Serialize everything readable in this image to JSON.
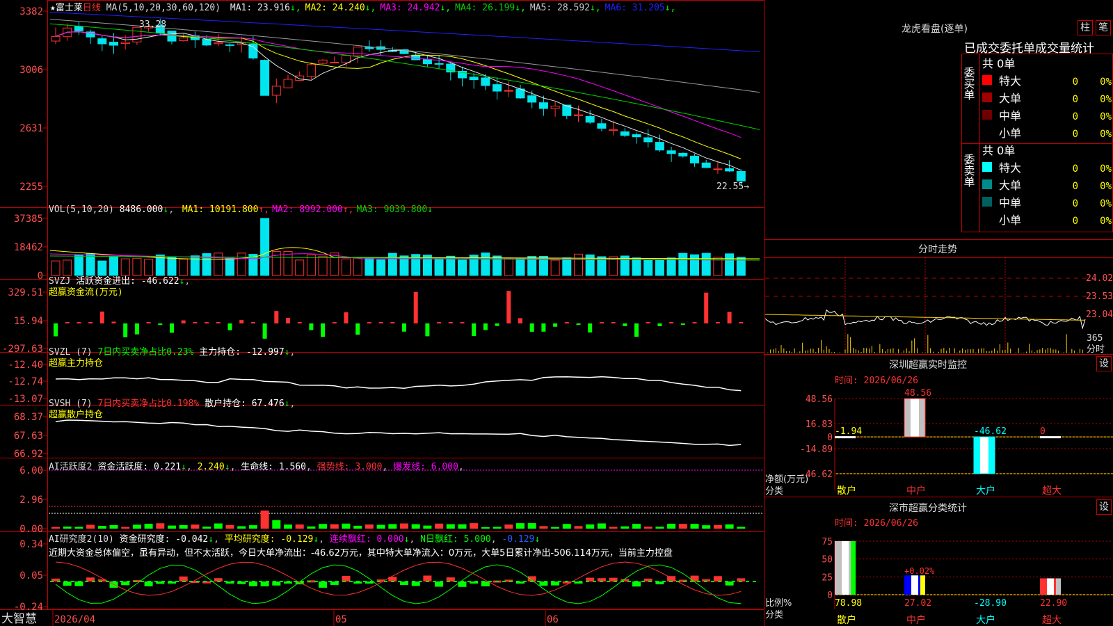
{
  "colors": {
    "up": "#ff3232",
    "down": "#00e5ee",
    "frame": "#c00000",
    "axis_text": "#ff5050",
    "ma1": "#e6e6e6",
    "ma2": "#ffff00",
    "ma3": "#ff00ff",
    "ma4": "#00d000",
    "ma5": "#9a9a9a",
    "ma6": "#2020ff",
    "green_bar": "#00ff00"
  },
  "main": {
    "stock_name": "富士莱",
    "period": "日线",
    "ma_header": "MA(5,10,20,30,60,120)",
    "ma_legend": [
      {
        "label": "MA1:",
        "value": "23.916",
        "color": "#e6e6e6"
      },
      {
        "label": "MA2:",
        "value": "24.240",
        "color": "#ffff00"
      },
      {
        "label": "MA3:",
        "value": "24.942",
        "color": "#ff00ff"
      },
      {
        "label": "MA4:",
        "value": "26.199",
        "color": "#00d000"
      },
      {
        "label": "MA5:",
        "value": "28.592",
        "color": "#c8c8c8"
      },
      {
        "label": "MA6:",
        "value": "31.205",
        "color": "#2020ff"
      }
    ],
    "y_ticks": [
      "3382",
      "3006",
      "2631",
      "2255"
    ],
    "high_annotation": "33.28",
    "low_annotation": "22.55"
  },
  "vol": {
    "header": "VOL(5,10,20)",
    "value": "8486.000",
    "legend": [
      {
        "label": "MA1:",
        "value": "10191.800",
        "color": "#ffff00"
      },
      {
        "label": "MA2:",
        "value": "8992.000",
        "color": "#ff00ff"
      },
      {
        "label": "MA3:",
        "value": "9039.800",
        "color": "#00d000"
      }
    ],
    "y_ticks": [
      "37385",
      "18462",
      "0"
    ]
  },
  "svzj": {
    "header": "SVZJ",
    "label": "活跃资金进出:",
    "value": "-46.622",
    "subtitle": "超赢资金流(万元)",
    "y_ticks": [
      "329.51",
      "15.94",
      "-297.63"
    ]
  },
  "svzl": {
    "header": "SVZL (7)",
    "ratio_text": "7日内买卖净占比0.23%",
    "label": "主力持仓:",
    "value": "-12.997",
    "subtitle": "超赢主力持仓",
    "y_ticks": [
      "-12.40",
      "-12.74",
      "-13.07"
    ]
  },
  "svsh": {
    "header": "SVSH (7)",
    "ratio_text": "7日内买卖净占比0.198%",
    "label": "散户持仓:",
    "value": "67.476",
    "subtitle": "超赢散户持仓",
    "y_ticks": [
      "68.37",
      "67.63",
      "66.92"
    ]
  },
  "ai_active": {
    "header": "AI活跃度2",
    "label": "资金活跃度:",
    "value1": "0.221",
    "value2": "2.240",
    "life_label": "生命线:",
    "life_value": "1.560",
    "strong": "强势线: 3.000",
    "burst": "爆发线: 6.000",
    "y_ticks": [
      "6.00",
      "2.96",
      "0.00"
    ]
  },
  "ai_research": {
    "header": "AI研究度2(10)",
    "label": "资金研究度:",
    "value": "-0.042",
    "avg": "平均研究度: -0.129",
    "consec": "连续飘红: 0.000",
    "nday": "N日飘红: 5.000",
    "last": "-0.129",
    "commentary": "近期大资金总体偏空，虽有异动，但不太活跃，今日大单净流出：-46.62万元，其中特大单净流入：0万元，大单5日累计净出-506.114万元，当前主力控盘",
    "y_ticks": [
      "0.34",
      "0.05",
      "-0.24"
    ]
  },
  "x_axis": {
    "brand": "大智慧",
    "labels": [
      "2026/04",
      "05",
      "06"
    ]
  },
  "right": {
    "lhkp_title": "龙虎看盘(逐单)",
    "btn_zhu": "柱",
    "btn_bi": "笔",
    "stats_title": "已成交委托单成交量统计",
    "buy_side": "委买单",
    "sell_side": "委卖单",
    "buy_total": "共 0单",
    "sell_total": "共 0单",
    "buy_rows": [
      {
        "name": "特大",
        "qty": "0",
        "pct": "0%",
        "color": "#ff0000"
      },
      {
        "name": "大单",
        "qty": "0",
        "pct": "0%",
        "color": "#a00000"
      },
      {
        "name": "中单",
        "qty": "0",
        "pct": "0%",
        "color": "#700000"
      },
      {
        "name": "小单",
        "qty": "0",
        "pct": "0%",
        "color": "#000000"
      }
    ],
    "sell_rows": [
      {
        "name": "特大",
        "qty": "0",
        "pct": "0%",
        "color": "#00ffff"
      },
      {
        "name": "大单",
        "qty": "0",
        "pct": "0%",
        "color": "#008b8b"
      },
      {
        "name": "中单",
        "qty": "0",
        "pct": "0%",
        "color": "#006060"
      },
      {
        "name": "小单",
        "qty": "0",
        "pct": "0%",
        "color": "#000000"
      }
    ],
    "intraday_title": "分时走势",
    "intraday_ticks": [
      "24.02",
      "23.53",
      "23.04"
    ],
    "intraday_vol": "365",
    "intraday_unit": "分时",
    "monitor_title": "深圳超赢实时监控",
    "monitor_btn": "设",
    "monitor_time": "时间: 2026/06/26",
    "monitor_ylabel": "净额(万元)",
    "monitor_xlabel": "分类",
    "monitor_ticks": [
      "48.56",
      "16.83",
      "0",
      "-14.89",
      "-46.62"
    ],
    "stats2_title": "深市超赢分类统计",
    "stats2_btn": "设",
    "stats2_time": "时间: 2026/06/26",
    "stats2_ylabel": "比例%",
    "stats2_xlabel": "分类",
    "stats2_ticks": [
      "75",
      "50",
      "25",
      "0"
    ],
    "stats2_extra": "+0.02%"
  },
  "chart_data": [
    {
      "type": "bar",
      "title": "深圳超赢实时监控",
      "ylabel": "净额(万元)",
      "categories": [
        "散户",
        "中户",
        "大户",
        "超大"
      ],
      "values": [
        -1.94,
        48.56,
        -46.62,
        0
      ],
      "ylim": [
        -46.62,
        48.56
      ]
    },
    {
      "type": "bar",
      "title": "深市超赢分类统计",
      "ylabel": "比例%",
      "categories": [
        "散户",
        "中户",
        "大户",
        "超大"
      ],
      "values": [
        78.98,
        27.02,
        -28.9,
        22.9
      ],
      "ylim": [
        0,
        75
      ]
    },
    {
      "type": "line",
      "title": "富士莱 日线",
      "ylim": [
        22.55,
        33.82
      ],
      "series": [
        {
          "name": "MA1",
          "values": [
            23.916
          ]
        },
        {
          "name": "MA2",
          "values": [
            24.24
          ]
        },
        {
          "name": "MA3",
          "values": [
            24.942
          ]
        },
        {
          "name": "MA4",
          "values": [
            26.199
          ]
        },
        {
          "name": "MA5",
          "values": [
            28.592
          ]
        },
        {
          "name": "MA6",
          "values": [
            31.205
          ]
        }
      ]
    }
  ]
}
